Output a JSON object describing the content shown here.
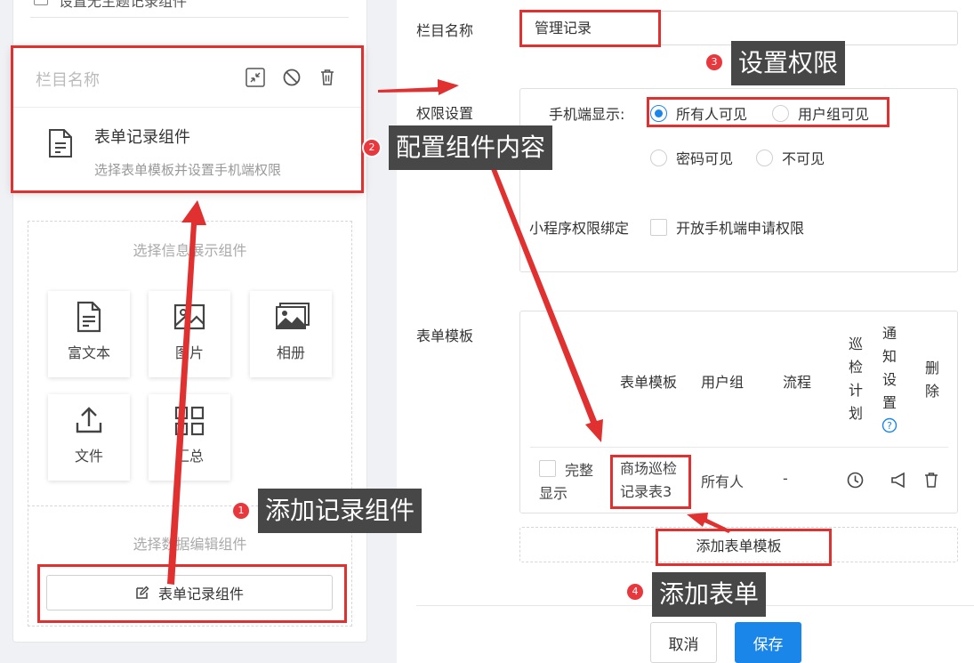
{
  "left": {
    "top_item_label": "设置无主题记录组件",
    "column_card": {
      "name_placeholder": "栏目名称",
      "component_title": "表单记录组件",
      "component_desc": "选择表单模板并设置手机端权限"
    },
    "info_section_title": "选择信息展示组件",
    "tiles": [
      {
        "label": "富文本",
        "icon": "rich-text-icon"
      },
      {
        "label": "图片",
        "icon": "image-icon"
      },
      {
        "label": "相册",
        "icon": "album-icon"
      },
      {
        "label": "文件",
        "icon": "upload-file-icon"
      },
      {
        "label": "汇总",
        "icon": "summary-grid-icon"
      }
    ],
    "edit_section_title": "选择数据编辑组件",
    "add_component_button": "表单记录组件"
  },
  "right": {
    "column_name_label": "栏目名称",
    "column_name_value": "管理记录",
    "permission_label": "权限设置",
    "mobile_display_label": "手机端显示:",
    "radio_options": [
      {
        "label": "所有人可见",
        "selected": true
      },
      {
        "label": "用户组可见",
        "selected": false
      },
      {
        "label": "密码可见",
        "selected": false
      },
      {
        "label": "不可见",
        "selected": false
      }
    ],
    "miniprogram_label": "小程序权限绑定",
    "miniprogram_checkbox_label": "开放手机端申请权限",
    "template_label": "表单模板",
    "table": {
      "headers": [
        "表单模板",
        "用户组",
        "流程",
        "巡检计划",
        "通知设置",
        "删除"
      ],
      "row": {
        "full_display_label": "完整显示",
        "template_name": "商场巡检记录表3",
        "user_group": "所有人",
        "workflow": "-"
      }
    },
    "add_template_button": "添加表单模板",
    "cancel_button": "取消",
    "save_button": "保存"
  },
  "annotations": [
    {
      "number": "1",
      "text": "添加记录组件"
    },
    {
      "number": "2",
      "text": "配置组件内容"
    },
    {
      "number": "3",
      "text": "设置权限"
    },
    {
      "number": "4",
      "text": "添加表单"
    }
  ],
  "colors": {
    "primary": "#1a86ea",
    "annotation_red": "#e03030",
    "callout_bg": "#474747"
  }
}
